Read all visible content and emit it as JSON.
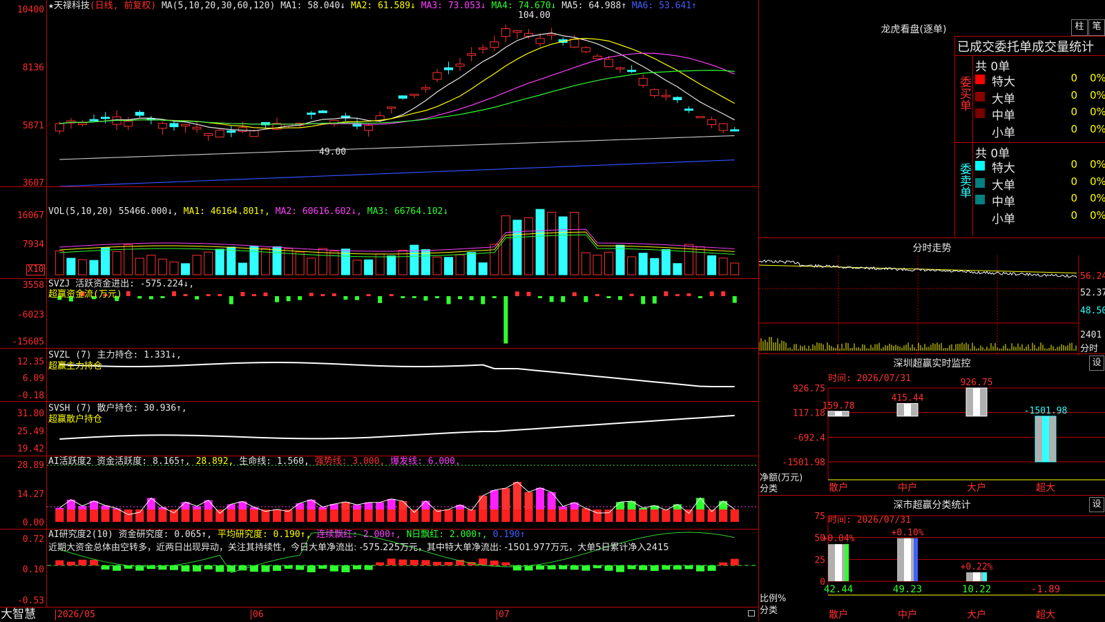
{
  "kline": {
    "star": "★",
    "stock_name": "天禄科技",
    "period": "(日线, 前复权)",
    "ma_label": "MA(5,10,20,30,60,120)",
    "ma1": "MA1: 58.040↓",
    "ma2": "MA2: 61.589↓",
    "ma3": "MA3: 73.053↓",
    "ma4": "MA4: 74.670↓",
    "ma5": "MA5: 64.988↑",
    "ma6": "MA6: 53.641↑",
    "y_ticks": [
      "10400",
      "8136",
      "5871",
      "3607"
    ],
    "high_mark": "104.00",
    "low_mark": "49.00"
  },
  "vol": {
    "label": "VOL(5,10,20)",
    "value": "55466.000↓,",
    "ma1": "MA1: 46164.801↑,",
    "ma2": "MA2: 60616.602↓,",
    "ma3": "MA3: 66764.102↓",
    "y_ticks": [
      "16067",
      "7934"
    ],
    "unit": "X10"
  },
  "svzj": {
    "label": "SVZJ  活跃资金进出: -575.224↓,",
    "sub": "超赢资金流(万元)",
    "y_ticks": [
      "3558",
      "-6023",
      "-15605"
    ]
  },
  "svzl": {
    "label": "SVZL (7) 主力持仓: 1.331↓,",
    "sub": "超赢主力持仓",
    "y_ticks": [
      "12.35",
      "6.09",
      "-0.18"
    ]
  },
  "svsh": {
    "label": "SVSH (7) 散户持仓: 30.936↑,",
    "sub": "超赢散户持仓",
    "y_ticks": [
      "31.80",
      "25.49",
      "19.42"
    ]
  },
  "ai1": {
    "label": "AI活跃度2 资金活跃度: 8.165↑,",
    "v2": "28.892,",
    "life": "生命线: 1.560,",
    "strong": "强势线: 3.000,",
    "burst": "爆发线: 6.000,",
    "y_ticks": [
      "28.89",
      "14.27",
      "0.00"
    ]
  },
  "ai2": {
    "label": "AI研究度2(10) 资金研究度: 0.065↑,",
    "avg": "平均研究度: 0.190↑,",
    "cons": "连续飘红: 2.000↑,",
    "nday": "N日飘红: 2.000↑,",
    "last": "0.190↑",
    "commentary": "近期大资金总体由空转多，近两日出现异动，关注其持续性，今日大单净流出: -575.225万元，其中特大单净流出: -1501.977万元，大单5日累计净入2415",
    "y_ticks": [
      "0.72",
      "0.10",
      "-0.53"
    ]
  },
  "bottom_bar": {
    "brand": "大智慧",
    "dates": [
      "2026/05",
      "06",
      "07"
    ]
  },
  "right": {
    "title": "龙虎看盘(逐单)",
    "btn_zhu": "柱",
    "btn_bi": "笔",
    "table_title": "已成交委托单成交量统计",
    "buy_side": "委买单",
    "sell_side": "委卖单",
    "buy_total": "共 0单",
    "sell_total": "共 0单",
    "buy_rows": [
      {
        "label": "特大",
        "count": "0",
        "pct": "0%",
        "color": "#ff0000"
      },
      {
        "label": "大单",
        "count": "0",
        "pct": "0%",
        "color": "#8b0000"
      },
      {
        "label": "中单",
        "count": "0",
        "pct": "0%",
        "color": "#7a0000"
      },
      {
        "label": "小单",
        "count": "0",
        "pct": "0%",
        "color": ""
      }
    ],
    "sell_rows": [
      {
        "label": "特大",
        "count": "0",
        "pct": "0%",
        "color": "#00ffff"
      },
      {
        "label": "大单",
        "count": "0",
        "pct": "0%",
        "color": "#008080"
      },
      {
        "label": "中单",
        "count": "0",
        "pct": "0%",
        "color": "#00807f"
      },
      {
        "label": "小单",
        "count": "0",
        "pct": "0%",
        "color": ""
      }
    ],
    "intraday_title": "分时走势",
    "intraday_ticks": [
      "56.24",
      "52.37",
      "48.50",
      "2401"
    ],
    "intraday_unit": "分时",
    "monitor_title": "深圳超赢实时监控",
    "monitor_btn": "设",
    "monitor_time": "时间: 2026/07/31",
    "monitor_ticks": [
      "926.75",
      "117.18",
      "-692.4",
      "-1501.98"
    ],
    "monitor_axis": "净额(万元)",
    "monitor_axis2": "分类",
    "monitor_cats": [
      "散户",
      "中户",
      "大户",
      "超大"
    ],
    "monitor_vals": [
      "159.78",
      "415.44",
      "926.75",
      "-1501.98"
    ],
    "stat_title": "深市超赢分类统计",
    "stat_btn": "设",
    "stat_time": "时间: 2026/07/31",
    "stat_ticks": [
      "75",
      "50",
      "25",
      "0"
    ],
    "stat_axis": "比例%",
    "stat_axis2": "分类",
    "stat_cats": [
      "散户",
      "中户",
      "大户",
      "超大"
    ],
    "stat_changes": [
      "+0.04%",
      "+0.10%",
      "+0.22%",
      ""
    ],
    "stat_vals": [
      "42.44",
      "49.23",
      "10.22",
      "-1.89"
    ]
  },
  "colors": {
    "up": "#ff3030",
    "down": "#30ffff",
    "grid": "#c00000"
  }
}
